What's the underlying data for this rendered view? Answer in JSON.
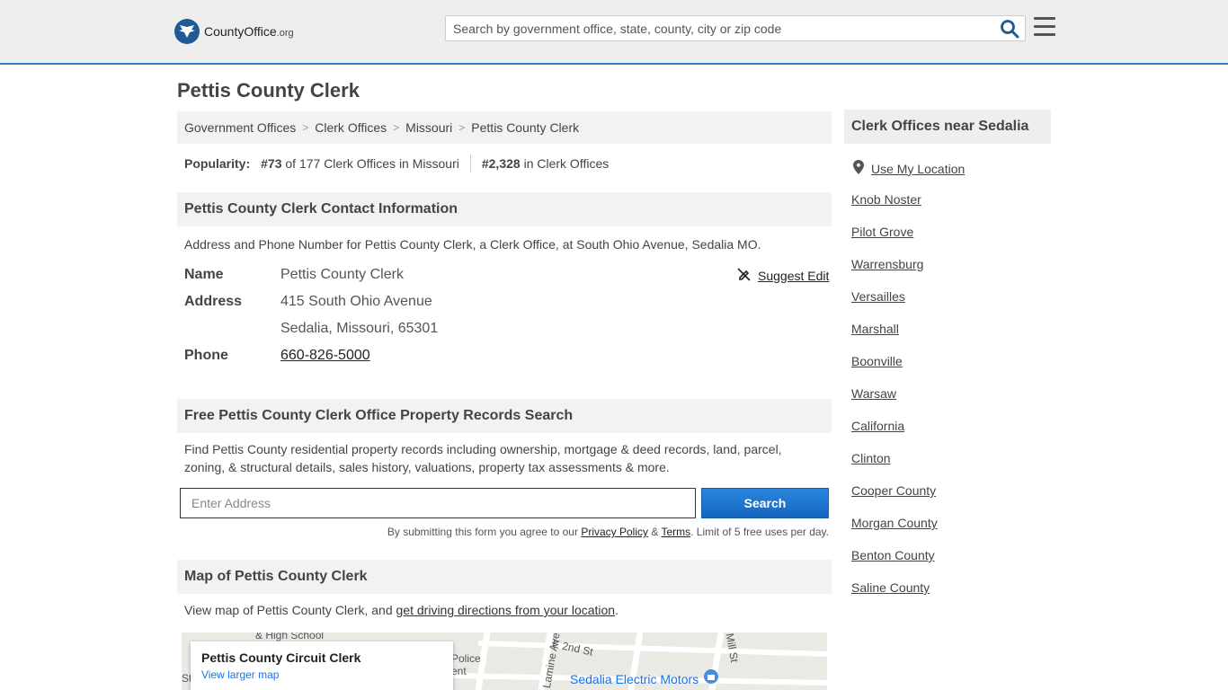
{
  "header": {
    "logo_main": "CountyOffice",
    "logo_tld": ".org",
    "search_placeholder": "Search by government office, state, county, city or zip code"
  },
  "page": {
    "title": "Pettis County Clerk"
  },
  "breadcrumb": [
    "Government Offices",
    "Clerk Offices",
    "Missouri",
    "Pettis County Clerk"
  ],
  "popularity": {
    "label": "Popularity:",
    "state_rank": "#73",
    "state_text": "of 177 Clerk Offices in Missouri",
    "national_rank": "#2,328",
    "national_text": "in Clerk Offices"
  },
  "contact": {
    "heading": "Pettis County Clerk Contact Information",
    "description": "Address and Phone Number for Pettis County Clerk, a Clerk Office, at South Ohio Avenue, Sedalia MO.",
    "name_label": "Name",
    "name_value": "Pettis County Clerk",
    "address_label": "Address",
    "address_line1": "415 South Ohio Avenue",
    "address_line2": "Sedalia, Missouri, 65301",
    "phone_label": "Phone",
    "phone_value": "660-826-5000",
    "suggest_edit": "Suggest Edit"
  },
  "property": {
    "heading": "Free Pettis County Clerk Office Property Records Search",
    "description_line1": "Find Pettis County residential property records including ownership, mortgage & deed records, land, parcel,",
    "description_line2": "zoning, & structural details, sales history, valuations, property tax assessments & more.",
    "input_placeholder": "Enter Address",
    "button_label": "Search",
    "disclaimer_prefix": "By submitting this form you agree to our ",
    "privacy_link": "Privacy Policy",
    "amp": " & ",
    "terms_link": "Terms",
    "disclaimer_suffix": ". Limit of 5 free uses per day."
  },
  "map": {
    "heading": "Map of Pettis County Clerk",
    "description_prefix": "View map of Pettis County Clerk, and ",
    "directions_link": "get driving directions from your location",
    "description_suffix": ".",
    "card_title": "Pettis County Circuit Clerk",
    "card_link": "View larger map",
    "labels": [
      "& High School",
      "Police",
      "ent",
      "E 2nd St",
      "Lamine Ave",
      "Sedalia Electric Motors",
      "Mill St",
      "St"
    ]
  },
  "sidebar": {
    "heading": "Clerk Offices near Sedalia",
    "use_location": "Use My Location",
    "items": [
      "Knob Noster",
      "Pilot Grove",
      "Warrensburg",
      "Versailles",
      "Marshall",
      "Boonville",
      "Warsaw",
      "California",
      "Clinton",
      "Cooper County",
      "Morgan County",
      "Benton County",
      "Saline County"
    ]
  },
  "colors": {
    "accent": "#2f7fc3",
    "button": "#1565c0",
    "logo": "#1d5a96"
  }
}
